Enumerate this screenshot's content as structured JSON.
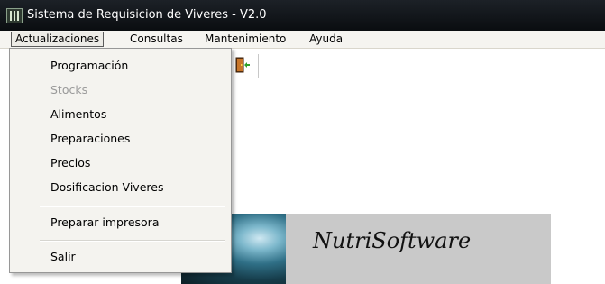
{
  "window": {
    "title": "Sistema de Requisicion de Viveres - V2.0"
  },
  "menubar": {
    "items": [
      {
        "label": "Actualizaciones"
      },
      {
        "label": "Consultas"
      },
      {
        "label": "Mantenimiento"
      },
      {
        "label": "Ayuda"
      }
    ],
    "open_index": 0
  },
  "dropdown": {
    "items": [
      {
        "label": "Programación",
        "enabled": true
      },
      {
        "label": "Stocks",
        "enabled": false
      },
      {
        "label": "Alimentos",
        "enabled": true
      },
      {
        "label": "Preparaciones",
        "enabled": true
      },
      {
        "label": "Precios",
        "enabled": true
      },
      {
        "label": "Dosificacion Viveres",
        "enabled": true
      },
      {
        "label": "Preparar impresora",
        "enabled": true
      },
      {
        "label": "Salir",
        "enabled": true
      }
    ]
  },
  "toolbar": {
    "buttons": [
      {
        "icon": "exit-door-icon"
      }
    ]
  },
  "logo": {
    "text": "NutriSoftware"
  },
  "colors": {
    "titlebar": "#0a0d10",
    "menubar": "#f5f4f0",
    "dropdown": "#f4f3ef",
    "disabled_text": "#9a9a9a",
    "logo_panel": "#c9c9c9"
  }
}
